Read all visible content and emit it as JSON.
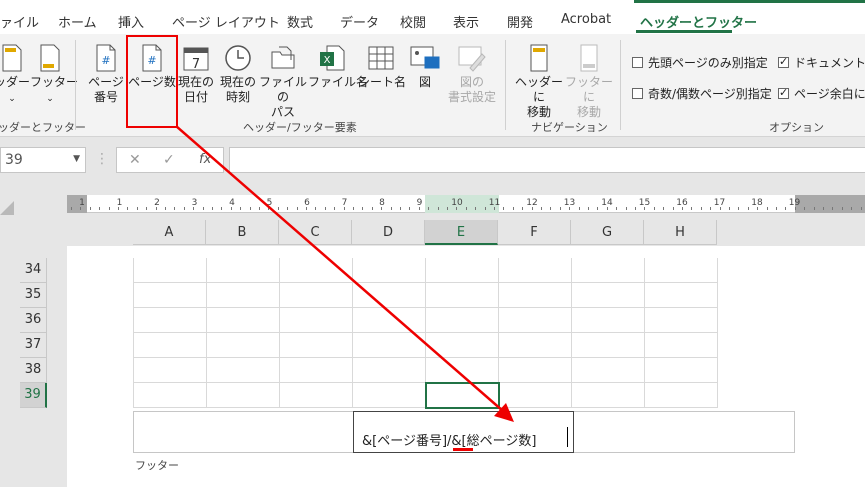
{
  "tabs": [
    "ァイル",
    "ホーム",
    "挿入",
    "ページ レイアウト",
    "数式",
    "データ",
    "校閲",
    "表示",
    "開発",
    "Acrobat",
    "ヘッダーとフッター"
  ],
  "ribbon": {
    "header_btn": "ッダー",
    "footer_btn": "フッター",
    "hf_group": "ッダーとフッター",
    "page_number": "ページ\n番号",
    "page_count": "ページ数",
    "current_date": "現在の\n日付",
    "current_time": "現在の\n時刻",
    "file_path": "ファイルの\nパス",
    "file_name": "ファイル名",
    "sheet_name": "シート名",
    "picture": "図",
    "format_picture": "図の\n書式設定",
    "elements_group": "ヘッダー/フッター要素",
    "goto_header": "ヘッダーに\n移動",
    "goto_footer": "フッターに\n移動",
    "nav_group": "ナビゲーション",
    "opt_first_page": "先頭ページのみ別指定",
    "opt_odd_even": "奇数/偶数ページ別指定",
    "opt_scale_doc": "ドキュメントに合",
    "opt_align_margins": "ページ余白に合",
    "options_group": "オプション",
    "icon_hash": "#",
    "icon_date": "7"
  },
  "formula_bar": {
    "name_box": "39",
    "cancel": "✕",
    "enter": "✓",
    "fx": "fx",
    "dots": "⋮"
  },
  "ruler": {
    "numbers": [
      "1",
      "1",
      "2",
      "3",
      "4",
      "5",
      "6",
      "7",
      "8",
      "9",
      "10",
      "11",
      "12",
      "13",
      "14",
      "15",
      "16",
      "17",
      "18",
      "19"
    ]
  },
  "columns": [
    "A",
    "B",
    "C",
    "D",
    "E",
    "F",
    "G",
    "H"
  ],
  "rows": [
    "34",
    "35",
    "36",
    "37",
    "38",
    "39"
  ],
  "footer": {
    "content": "&[ページ番号]/&[総ページ数]",
    "label": "フッター"
  },
  "colors": {
    "accent": "#217346",
    "annotation": "#e00000"
  }
}
